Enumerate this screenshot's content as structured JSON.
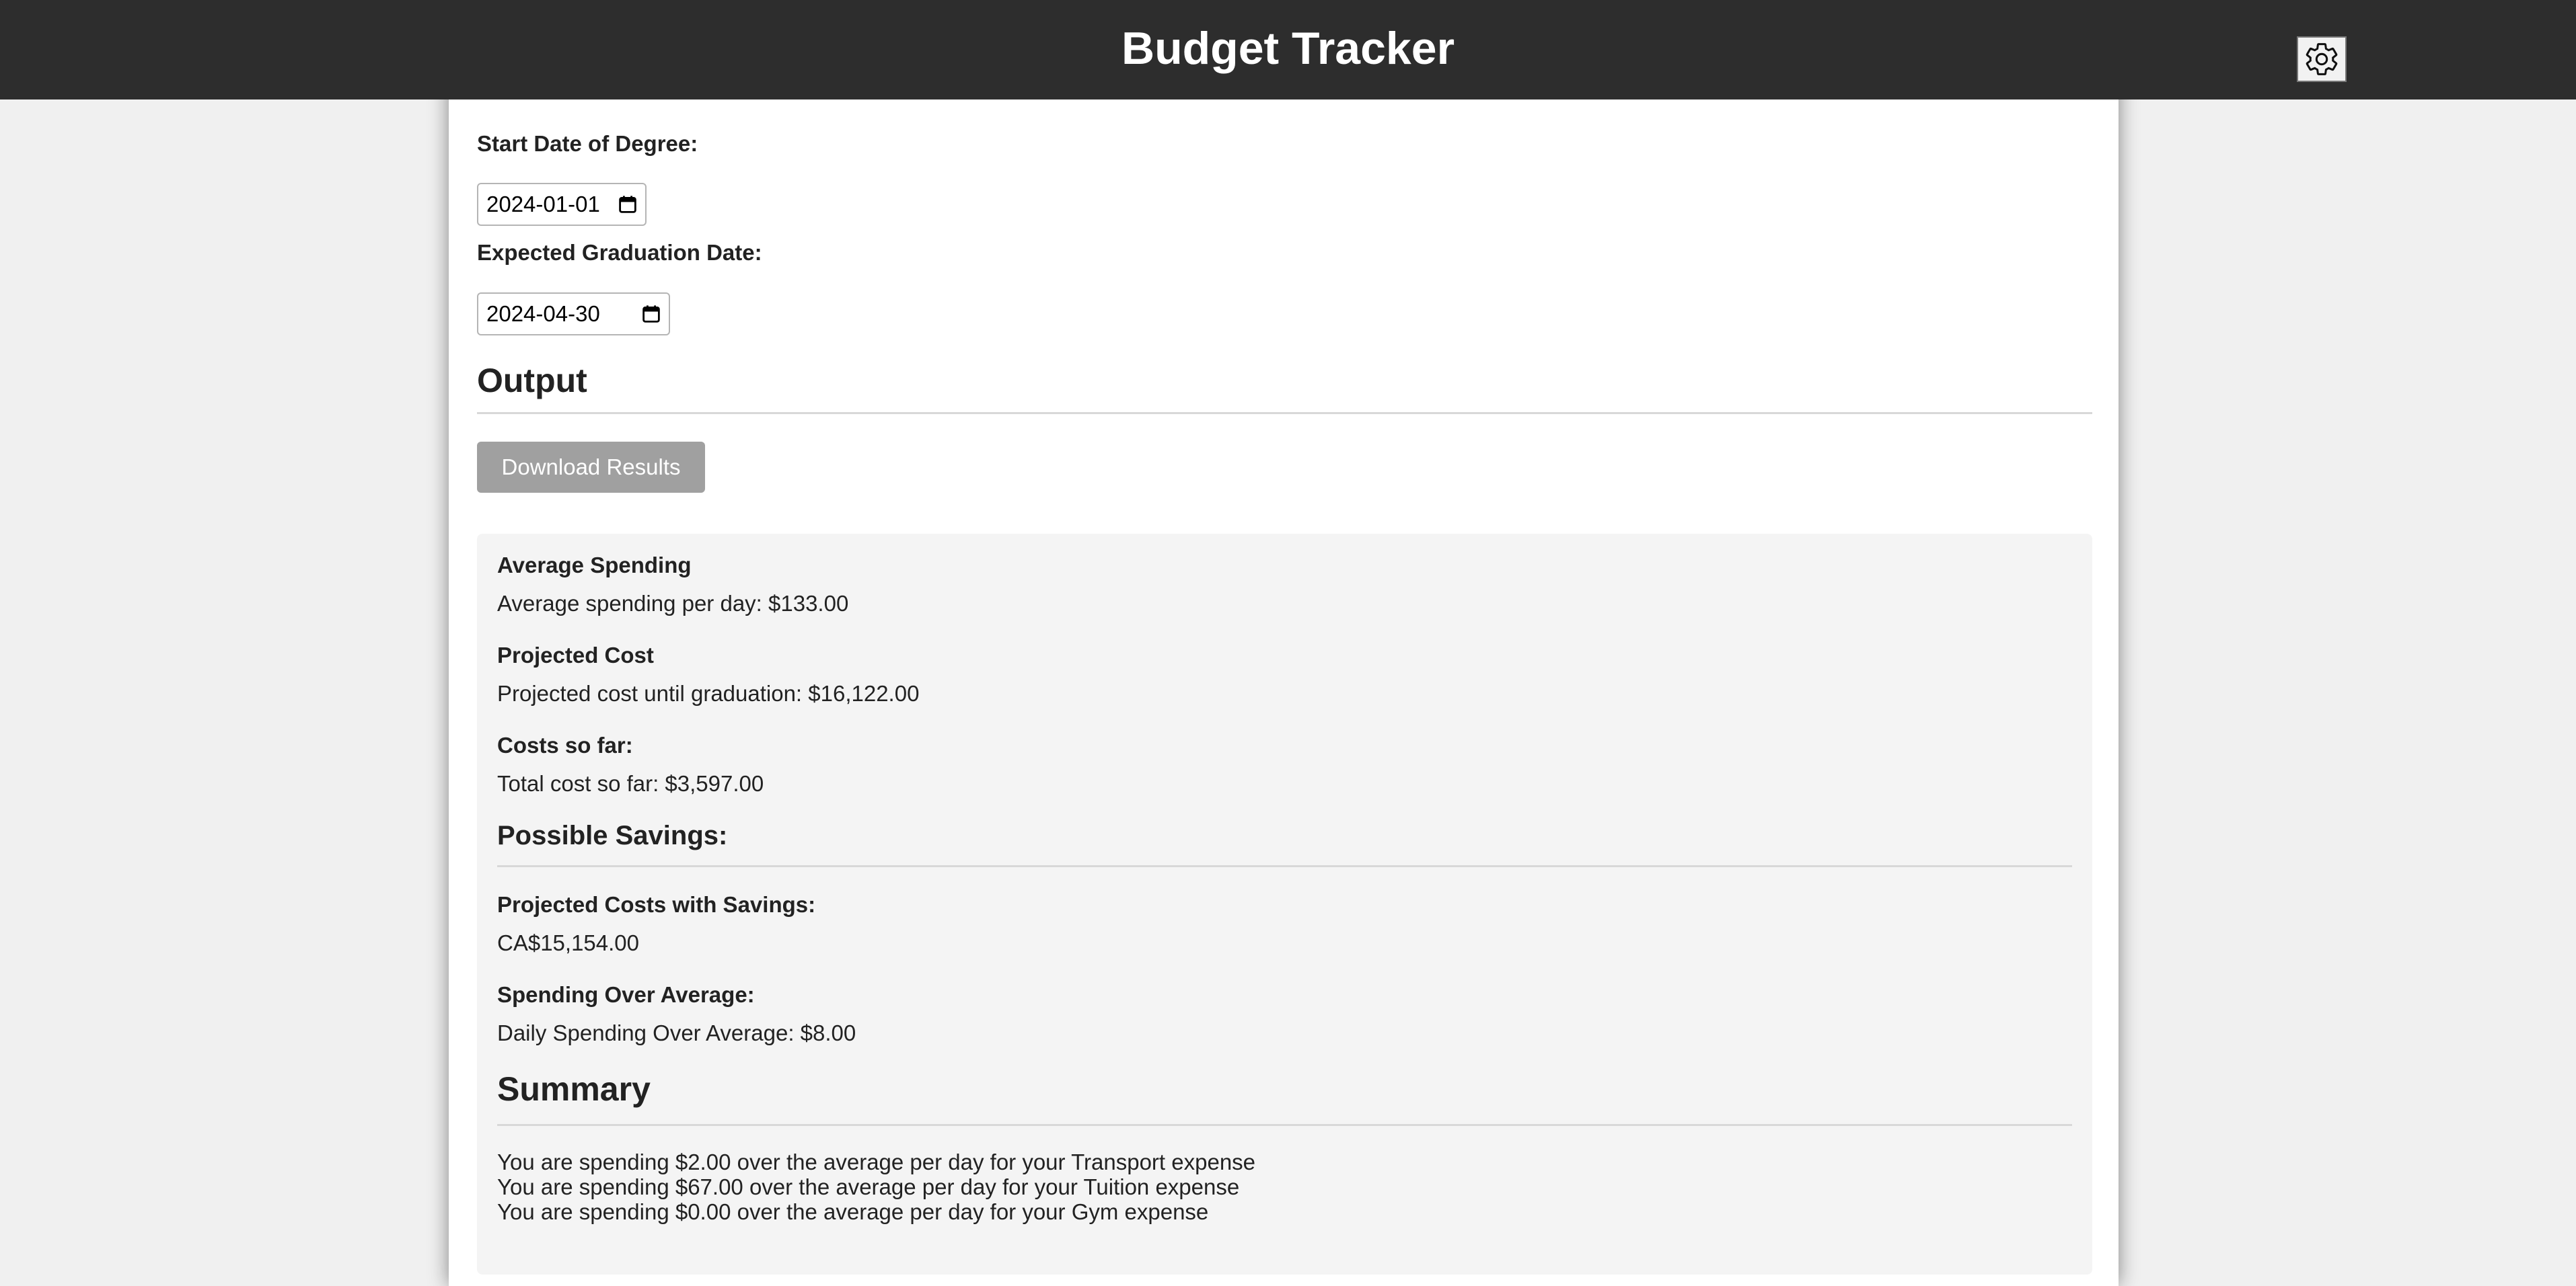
{
  "app": {
    "title": "Budget Tracker",
    "settings_icon": "gear-icon"
  },
  "form": {
    "start_date": {
      "label": "Start Date of Degree:",
      "value": "2024-01-01",
      "icon": "calendar-icon"
    },
    "graduation_date": {
      "label": "Expected Graduation Date:",
      "value": "2024-04-30",
      "icon": "calendar-icon"
    }
  },
  "output": {
    "title": "Output",
    "download_label": "Download Results"
  },
  "results": {
    "average_spending": {
      "heading": "Average Spending",
      "text": "Average spending per day: $133.00"
    },
    "projected_cost": {
      "heading": "Projected Cost",
      "text": "Projected cost until graduation: $16,122.00"
    },
    "costs_so_far": {
      "heading": "Costs so far:",
      "text": "Total cost so far: $3,597.00"
    },
    "possible_savings": {
      "title": "Possible Savings:"
    },
    "projected_with_savings": {
      "heading": "Projected Costs with Savings:",
      "text": "CA$15,154.00"
    },
    "spending_over_average": {
      "heading": "Spending Over Average:",
      "text": "Daily Spending Over Average: $8.00"
    },
    "summary": {
      "title": "Summary",
      "lines": [
        "You are spending $2.00 over the average per day for your Transport expense",
        "You are spending $67.00 over the average per day for your Tuition expense",
        "You are spending $0.00 over the average per day for your Gym expense"
      ]
    }
  },
  "colors": {
    "header_bg": "#2d2d2d",
    "page_bg": "#f0f0f0",
    "panel_bg": "#ffffff",
    "results_bg": "#f4f4f4",
    "button_bg": "#a0a0a0",
    "text": "#222222"
  }
}
